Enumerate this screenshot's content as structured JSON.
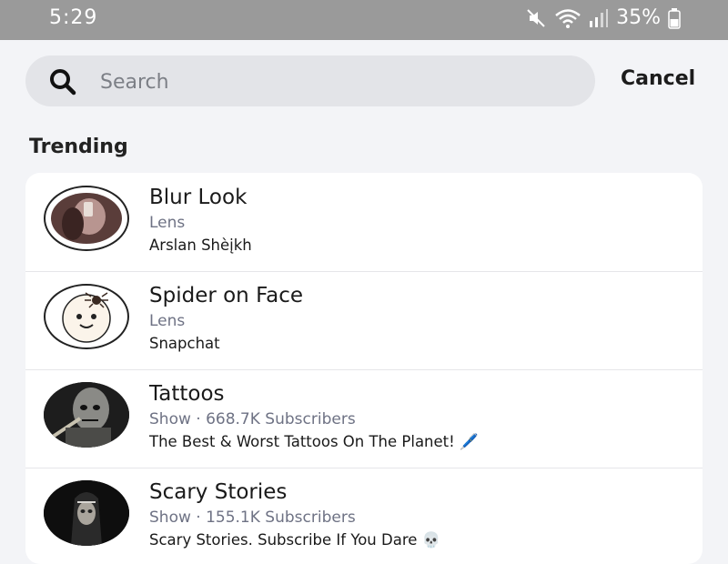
{
  "status_bar": {
    "time": "5:29",
    "battery": "35%",
    "icons": [
      "mute-icon",
      "wifi-icon",
      "signal-icon",
      "battery-icon"
    ]
  },
  "search": {
    "placeholder": "Search",
    "value": "",
    "cancel_label": "Cancel"
  },
  "trending": {
    "title": "Trending",
    "items": [
      {
        "title": "Blur Look",
        "subtitle": "Lens",
        "description": "Arslan Shèįkh"
      },
      {
        "title": "Spider on Face",
        "subtitle": "Lens",
        "description": "Snapchat"
      },
      {
        "title": "Tattoos",
        "subtitle": "Show · 668.7K Subscribers",
        "description": "The Best & Worst Tattoos On The Planet! 🖊️"
      },
      {
        "title": "Scary Stories",
        "subtitle": "Show · 155.1K Subscribers",
        "description": "Scary Stories. Subscribe If You Dare 💀"
      }
    ]
  }
}
